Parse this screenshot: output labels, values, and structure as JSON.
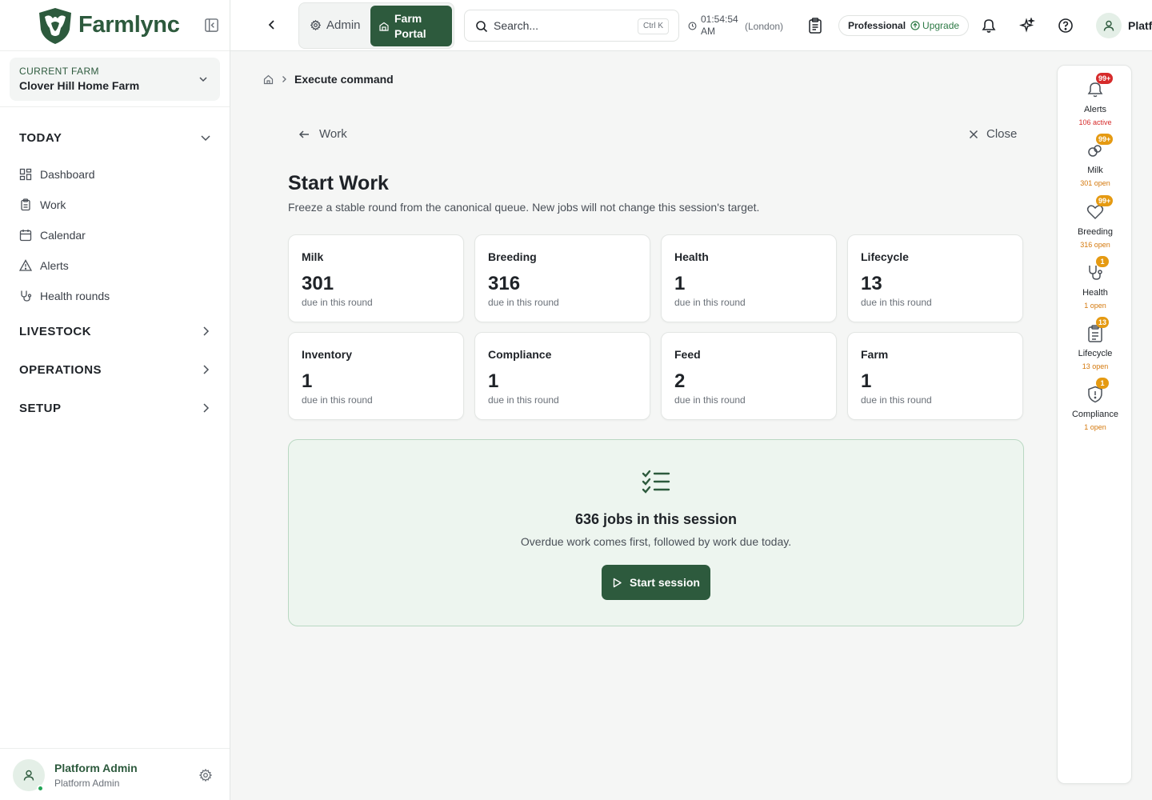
{
  "colors": {
    "brand": "#2d5a3d",
    "alert_red": "#d62b2b",
    "warn_orange": "#e59a12",
    "session_bg": "#edf5ef"
  },
  "brand": {
    "name": "Farmlync"
  },
  "farm": {
    "label": "CURRENT FARM",
    "name": "Clover Hill Home Farm"
  },
  "sidebar": {
    "today_label": "TODAY",
    "today_items": [
      {
        "label": "Dashboard",
        "icon": "dashboard-icon"
      },
      {
        "label": "Work",
        "icon": "clipboard-icon"
      },
      {
        "label": "Calendar",
        "icon": "calendar-icon"
      },
      {
        "label": "Alerts",
        "icon": "warning-icon"
      },
      {
        "label": "Health rounds",
        "icon": "stethoscope-icon"
      }
    ],
    "sections": [
      "LIVESTOCK",
      "OPERATIONS",
      "SETUP"
    ]
  },
  "user": {
    "name": "Platform Admin",
    "role": "Platform Admin",
    "topbar_name": "Platf"
  },
  "topbar": {
    "admin_label": "Admin",
    "farm_portal_line1": "Farm",
    "farm_portal_line2": "Portal",
    "search_placeholder": "Search...",
    "search_shortcut": "Ctrl K",
    "time_line1": "01:54:54",
    "time_line2": "AM",
    "timezone": "(London)",
    "plan": "Professional",
    "upgrade": "Upgrade"
  },
  "breadcrumb": {
    "current": "Execute command"
  },
  "page": {
    "back_label": "Work",
    "close_label": "Close",
    "title": "Start Work",
    "subtitle": "Freeze a stable round from the canonical queue. New jobs will not change this session's target."
  },
  "cards": [
    {
      "label": "Milk",
      "value": "301",
      "sub": "due in this round"
    },
    {
      "label": "Breeding",
      "value": "316",
      "sub": "due in this round"
    },
    {
      "label": "Health",
      "value": "1",
      "sub": "due in this round"
    },
    {
      "label": "Lifecycle",
      "value": "13",
      "sub": "due in this round"
    },
    {
      "label": "Inventory",
      "value": "1",
      "sub": "due in this round"
    },
    {
      "label": "Compliance",
      "value": "1",
      "sub": "due in this round"
    },
    {
      "label": "Feed",
      "value": "2",
      "sub": "due in this round"
    },
    {
      "label": "Farm",
      "value": "1",
      "sub": "due in this round"
    }
  ],
  "session": {
    "title": "636 jobs in this session",
    "subtitle": "Overdue work comes first, followed by work due today.",
    "button": "Start session"
  },
  "rail": [
    {
      "name": "Alerts",
      "badge": "99+",
      "stat": "106 active",
      "icon": "bell-icon",
      "tone": "red"
    },
    {
      "name": "Milk",
      "badge": "99+",
      "stat": "301 open",
      "icon": "milk-drops-icon",
      "tone": "orange"
    },
    {
      "name": "Breeding",
      "badge": "99+",
      "stat": "316 open",
      "icon": "heart-icon",
      "tone": "orange"
    },
    {
      "name": "Health",
      "badge": "1",
      "stat": "1 open",
      "icon": "stethoscope-icon",
      "tone": "orange"
    },
    {
      "name": "Lifecycle",
      "badge": "13",
      "stat": "13 open",
      "icon": "clipboard-list-icon",
      "tone": "orange"
    },
    {
      "name": "Compliance",
      "badge": "1",
      "stat": "1 open",
      "icon": "shield-alert-icon",
      "tone": "orange"
    }
  ]
}
